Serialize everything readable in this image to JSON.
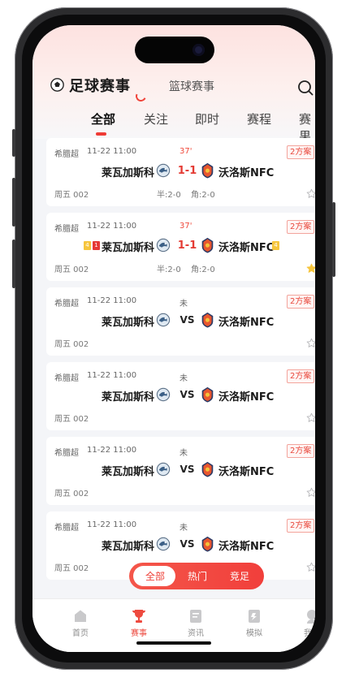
{
  "header": {
    "title": "足球赛事",
    "subtitle": "篮球赛事"
  },
  "tabs": [
    "全部",
    "关注",
    "即时",
    "赛程",
    "赛果"
  ],
  "active_tab": "全部",
  "matches": [
    {
      "league": "希腊超",
      "time": "11-22 11:00",
      "status": "37'",
      "live": true,
      "plan": "2方案",
      "home": "莱瓦加斯科",
      "score": "1-1",
      "away": "沃洛斯NFC",
      "code": "周五 002",
      "half": "半:2-0",
      "corner": "角:2-0",
      "starred": false,
      "cards": null
    },
    {
      "league": "希腊超",
      "time": "11-22 11:00",
      "status": "37'",
      "live": true,
      "plan": "2方案",
      "home": "莱瓦加斯科",
      "score": "1-1",
      "away": "沃洛斯NFC",
      "code": "周五 002",
      "half": "半:2-0",
      "corner": "角:2-0",
      "starred": true,
      "cards": {
        "home_yellow": "4",
        "home_red": "1",
        "away_yellow": "4"
      }
    },
    {
      "league": "希腊超",
      "time": "11-22 11:00",
      "status": "未",
      "live": false,
      "plan": "2方案",
      "home": "莱瓦加斯科",
      "score": "VS",
      "away": "沃洛斯NFC",
      "code": "周五 002",
      "half": "",
      "corner": "",
      "starred": false,
      "cards": null
    },
    {
      "league": "希腊超",
      "time": "11-22 11:00",
      "status": "未",
      "live": false,
      "plan": "2方案",
      "home": "莱瓦加斯科",
      "score": "VS",
      "away": "沃洛斯NFC",
      "code": "周五 002",
      "half": "",
      "corner": "",
      "starred": false,
      "cards": null
    },
    {
      "league": "希腊超",
      "time": "11-22 11:00",
      "status": "未",
      "live": false,
      "plan": "2方案",
      "home": "莱瓦加斯科",
      "score": "VS",
      "away": "沃洛斯NFC",
      "code": "周五 002",
      "half": "",
      "corner": "",
      "starred": false,
      "cards": null
    },
    {
      "league": "希腊超",
      "time": "11-22 11:00",
      "status": "未",
      "live": false,
      "plan": "2方案",
      "home": "莱瓦加斯科",
      "score": "VS",
      "away": "沃洛斯NFC",
      "code": "周五 002",
      "half": "",
      "corner": "",
      "starred": false,
      "cards": null
    }
  ],
  "filter": {
    "items": [
      "全部",
      "热门",
      "竞足"
    ],
    "active": "全部"
  },
  "tabbar": {
    "items": [
      {
        "label": "首页",
        "icon": "home-icon"
      },
      {
        "label": "赛事",
        "icon": "trophy-icon"
      },
      {
        "label": "资讯",
        "icon": "news-icon"
      },
      {
        "label": "模拟",
        "icon": "simulate-icon"
      },
      {
        "label": "我的",
        "icon": "profile-icon"
      }
    ],
    "active": "赛事"
  },
  "colors": {
    "accent": "#ef3b35",
    "plan_border": "#f3a49c",
    "star": "#f6c53d"
  }
}
